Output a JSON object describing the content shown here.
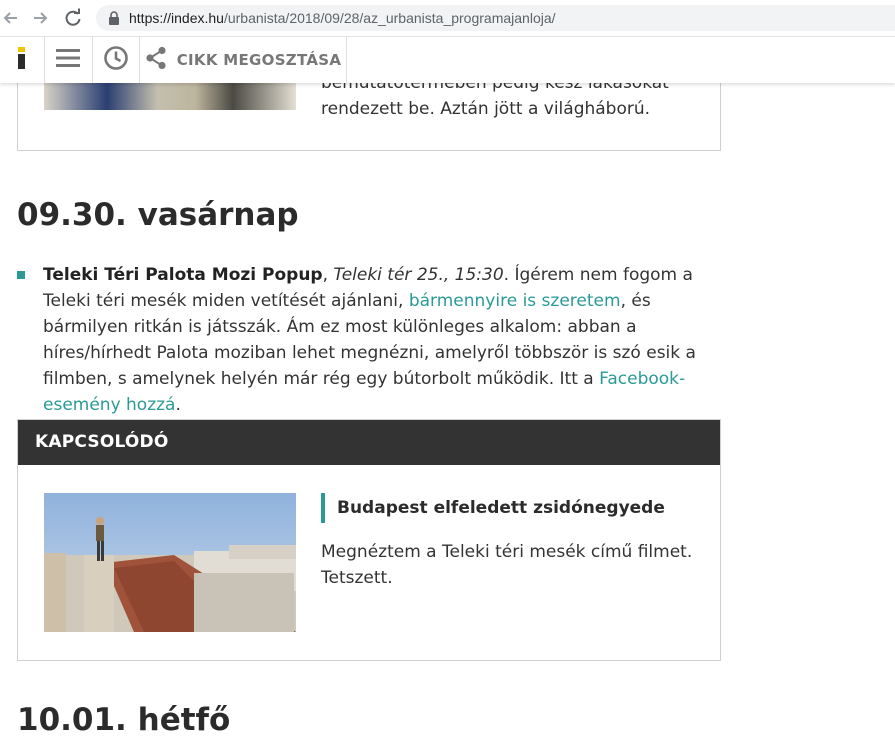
{
  "browser": {
    "url_host": "https://index.hu",
    "url_path": "/urbanista/2018/09/28/az_urbanista_programajanloja/"
  },
  "toolbar": {
    "share_label": "CIKK MEGOSZTÁSA",
    "icons": [
      "logo-icon",
      "menu-icon",
      "clock-icon",
      "share-icon"
    ]
  },
  "previous_item": {
    "text": "bemutatótermében pedig kész lakásokat rendezett be. Aztán jött a világháború."
  },
  "day_sunday": {
    "heading": "09.30. vasárnap"
  },
  "program": {
    "title": "Teleki Téri Palota Mozi Popup",
    "sep1": ", ",
    "location_time": "Teleki tér 25., 15:30",
    "text1": ". Ígérem nem fogom a Teleki téri mesék miden vetítését ajánlani, ",
    "link1": "bármennyire is szeretem",
    "text2": ", és bármilyen ritkán is játsszák. Ám ez most különleges alkalom: abban a híres/hírhedt Palota moziban lehet megnézni, amelyről többször is szó esik a filmben, s amelynek helyén már rég egy bútorbolt működik. Itt a ",
    "link2": "Facebook-esemény hozzá",
    "text3": "."
  },
  "related": {
    "header": "KAPCSOLÓDÓ",
    "title": "Budapest elfeledett zsidónegyede",
    "description": "Megnéztem a Teleki téri mesék című filmet. Tetszett."
  },
  "day_monday": {
    "heading": "10.01. hétfő"
  },
  "colors": {
    "accent": "#2a9a96",
    "header_bg": "#333333",
    "logo_yellow": "#f1c400"
  }
}
